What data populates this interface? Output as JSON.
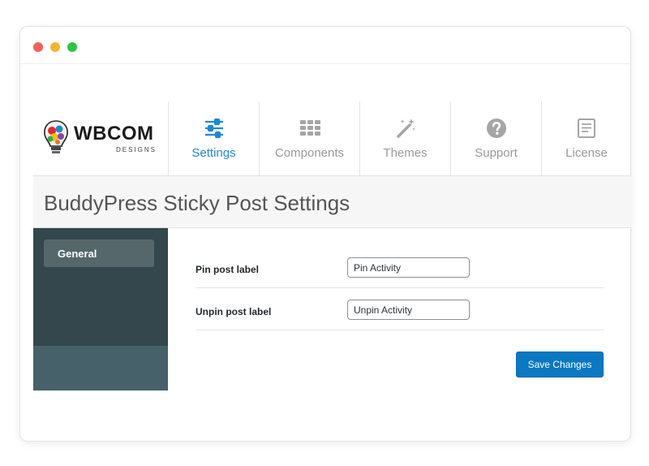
{
  "window": {
    "controls": {
      "close_color": "#f2615b",
      "minimize_color": "#f6b52e",
      "maximize_color": "#2bc641"
    }
  },
  "logo": {
    "name": "WBCOM",
    "subtitle": "DESIGNS"
  },
  "nav": {
    "accent_color": "#1e88d6",
    "tabs": [
      {
        "label": "Settings",
        "icon": "sliders-icon",
        "active": true
      },
      {
        "label": "Components",
        "icon": "grid-icon",
        "active": false
      },
      {
        "label": "Themes",
        "icon": "magic-wand-icon",
        "active": false
      },
      {
        "label": "Support",
        "icon": "question-circle-icon",
        "active": false
      },
      {
        "label": "License",
        "icon": "document-icon",
        "active": false
      }
    ]
  },
  "page": {
    "title": "BuddyPress Sticky Post Settings"
  },
  "sidebar": {
    "items": [
      {
        "label": "General",
        "active": true
      }
    ]
  },
  "form": {
    "fields": [
      {
        "label": "Pin post label",
        "value": "Pin Activity"
      },
      {
        "label": "Unpin post label",
        "value": "Unpin Activity"
      }
    ],
    "save_label": "Save Changes"
  }
}
